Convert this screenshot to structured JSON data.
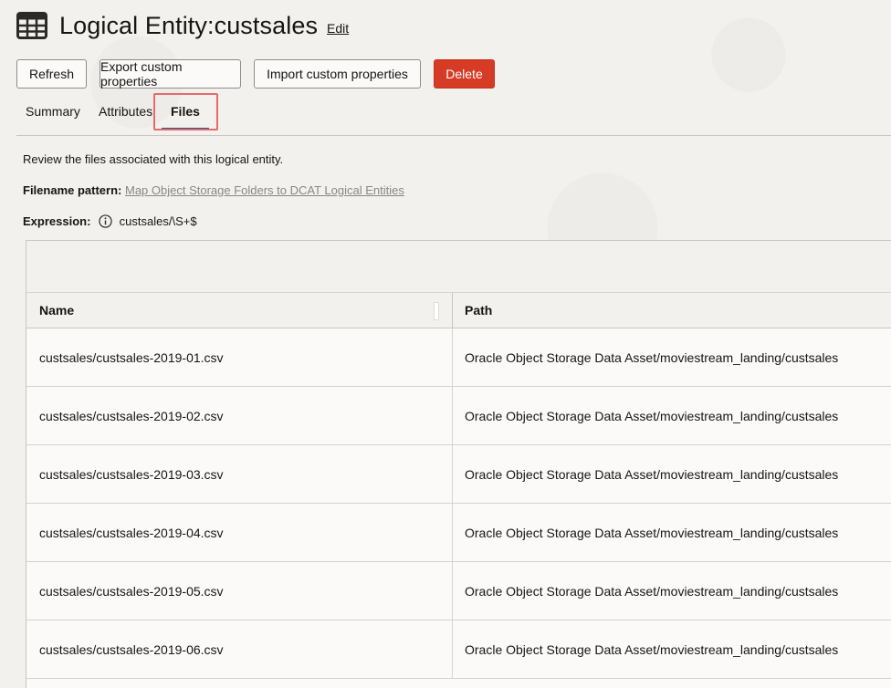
{
  "header": {
    "title": "Logical Entity:custsales",
    "edit_label": "Edit",
    "icon": "table-icon"
  },
  "toolbar": {
    "refresh_label": "Refresh",
    "export_label": "Export custom properties",
    "import_label": "Import custom properties",
    "delete_label": "Delete",
    "delete_color": "#d63b25"
  },
  "tabs": [
    {
      "label": "Summary",
      "active": false
    },
    {
      "label": "Attributes",
      "active": false
    },
    {
      "label": "Files",
      "active": true
    }
  ],
  "files": {
    "description": "Review the files associated with this logical entity.",
    "pattern_label": "Filename pattern:",
    "pattern_link": "Map Object Storage Folders to DCAT Logical Entities",
    "expression_label": "Expression:",
    "expression_value": "custsales/\\S+$"
  },
  "table": {
    "columns": [
      "Name",
      "Path"
    ],
    "rows": [
      {
        "name": "custsales/custsales-2019-01.csv",
        "path": "Oracle Object Storage Data Asset/moviestream_landing/custsales"
      },
      {
        "name": "custsales/custsales-2019-02.csv",
        "path": "Oracle Object Storage Data Asset/moviestream_landing/custsales"
      },
      {
        "name": "custsales/custsales-2019-03.csv",
        "path": "Oracle Object Storage Data Asset/moviestream_landing/custsales"
      },
      {
        "name": "custsales/custsales-2019-04.csv",
        "path": "Oracle Object Storage Data Asset/moviestream_landing/custsales"
      },
      {
        "name": "custsales/custsales-2019-05.csv",
        "path": "Oracle Object Storage Data Asset/moviestream_landing/custsales"
      },
      {
        "name": "custsales/custsales-2019-06.csv",
        "path": "Oracle Object Storage Data Asset/moviestream_landing/custsales"
      }
    ]
  }
}
